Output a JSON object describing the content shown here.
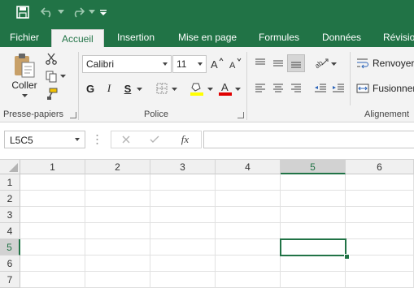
{
  "quick_access": {
    "icons": [
      "save-icon",
      "undo-icon",
      "redo-icon",
      "customize-icon"
    ]
  },
  "tabs": [
    "Fichier",
    "Accueil",
    "Insertion",
    "Mise en page",
    "Formules",
    "Données",
    "Révisio"
  ],
  "active_tab": "Accueil",
  "ribbon": {
    "clipboard": {
      "label": "Presse-papiers",
      "paste_label": "Coller"
    },
    "font": {
      "label": "Police",
      "font_name": "Calibri",
      "font_size": "11",
      "bold": "G",
      "italic": "I",
      "underline": "S",
      "fill_color": "#ffff00",
      "font_color": "#e00000"
    },
    "alignment": {
      "label": "Alignement",
      "wrap_label": "Renvoyer",
      "merge_label": "Fusionner"
    }
  },
  "formula_bar": {
    "name_box": "L5C5",
    "fx": "fx",
    "value": ""
  },
  "sheet": {
    "columns": [
      "1",
      "2",
      "3",
      "4",
      "5",
      "6"
    ],
    "rows": [
      "1",
      "2",
      "3",
      "4",
      "5",
      "6",
      "7"
    ],
    "selected_cell": "L5C5",
    "selected_column": "5",
    "selected_row": "5"
  },
  "colors": {
    "accent": "#217346"
  }
}
